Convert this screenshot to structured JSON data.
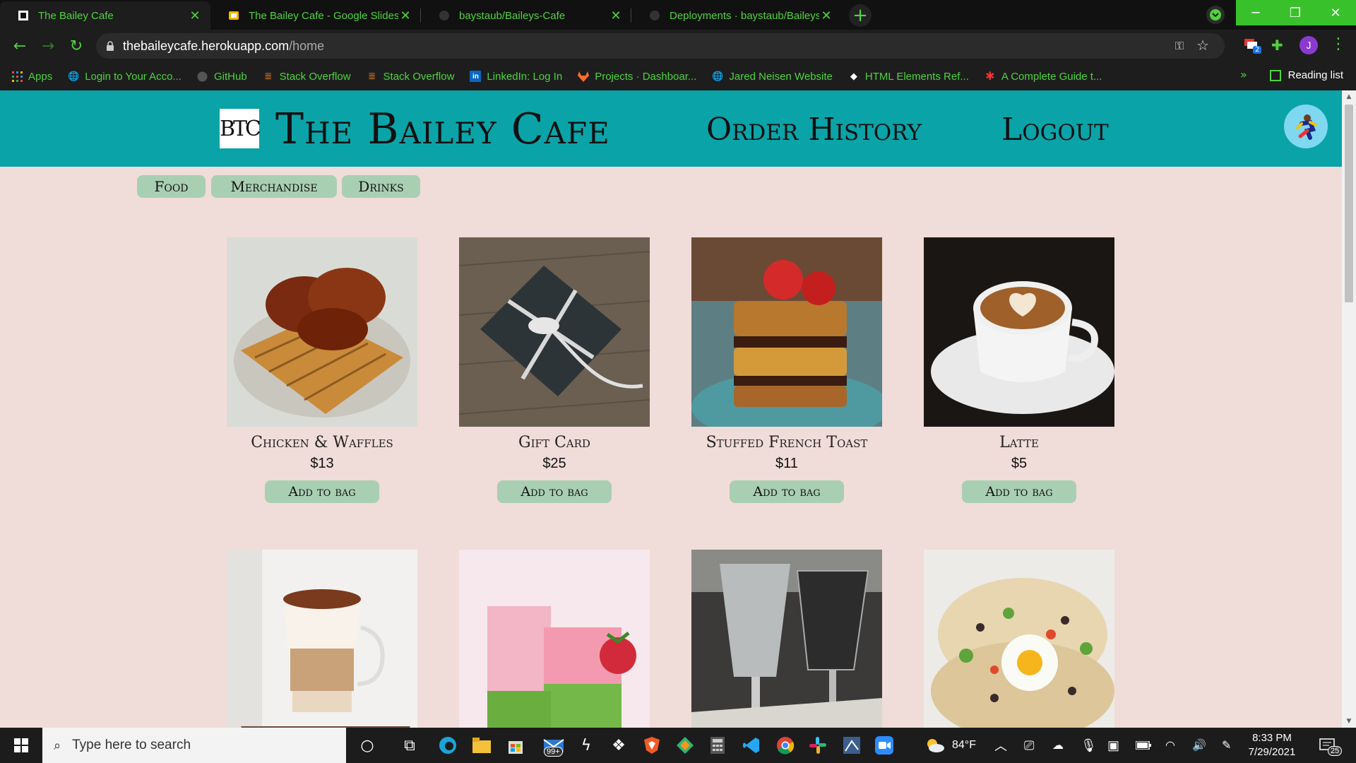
{
  "browser": {
    "tabs": [
      {
        "title": "The Bailey Cafe",
        "icon": "cafe-favicon"
      },
      {
        "title": "The Bailey Cafe - Google Slides",
        "icon": "slides-favicon"
      },
      {
        "title": "baystaub/Baileys-Cafe",
        "icon": "github-favicon"
      },
      {
        "title": "Deployments · baystaub/Baileys-C",
        "icon": "github-favicon"
      }
    ],
    "url_host": "thebaileycafe.herokuapp.com",
    "url_path": "/home",
    "profile_initial": "J",
    "extension_badge": "2",
    "bookmarks": [
      {
        "label": "Apps",
        "icon": "apps-grid-icon"
      },
      {
        "label": "Login to Your Acco...",
        "icon": "globe-icon"
      },
      {
        "label": "GitHub",
        "icon": "github-icon"
      },
      {
        "label": "Stack Overflow",
        "icon": "stackoverflow-icon"
      },
      {
        "label": "Stack Overflow",
        "icon": "stackoverflow-icon"
      },
      {
        "label": "LinkedIn: Log In",
        "icon": "linkedin-icon"
      },
      {
        "label": "Projects · Dashboar...",
        "icon": "gitlab-icon"
      },
      {
        "label": "Jared Neisen Website",
        "icon": "globe-icon"
      },
      {
        "label": "HTML Elements Ref...",
        "icon": "mdn-icon"
      },
      {
        "label": "A Complete Guide t...",
        "icon": "star-asterisk-icon"
      }
    ],
    "more_bookmarks": "»",
    "reading_list": "Reading list"
  },
  "site": {
    "logo_text": "BTC",
    "title": "The Bailey Cafe",
    "nav": [
      "Order History",
      "Logout"
    ],
    "categories": [
      "Food",
      "Merchandise",
      "Drinks"
    ],
    "add_label": "Add to bag",
    "products": [
      {
        "name": "Chicken & Waffles",
        "price": "$13"
      },
      {
        "name": "Gift Card",
        "price": "$25"
      },
      {
        "name": "Stuffed French Toast",
        "price": "$11"
      },
      {
        "name": "Latte",
        "price": "$5"
      }
    ]
  },
  "taskbar": {
    "search_placeholder": "Type here to search",
    "mail_badge": "99+",
    "weather": "84°F",
    "time": "8:33 PM",
    "date": "7/29/2021",
    "notification_count": "25"
  },
  "colors": {
    "header": "#0aa3a8",
    "background": "#f0dcd8",
    "button": "#a9cfb3",
    "chrome_accent": "#4fd33d"
  }
}
